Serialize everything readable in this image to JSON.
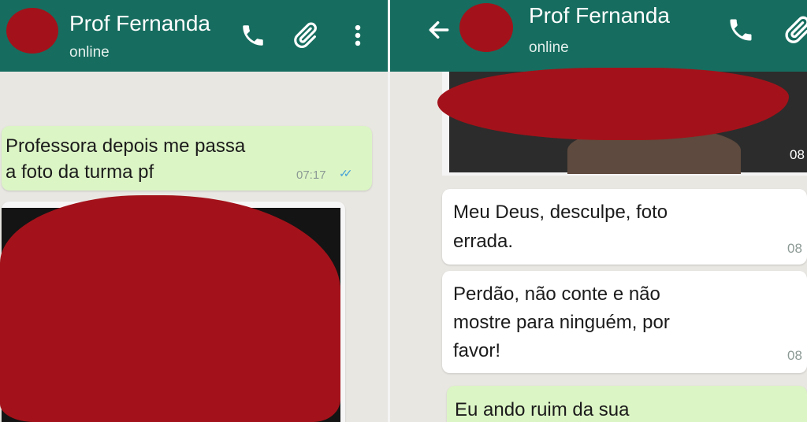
{
  "left_chat": {
    "contact_name": "Prof Fernanda",
    "status": "online",
    "icons": [
      "phone-icon",
      "attach-icon",
      "menu-icon"
    ],
    "messages": [
      {
        "text_line1": "Professora depois me passa",
        "text_line2": "a foto da turma pf",
        "time": "07:17",
        "read_status": "✓✓"
      }
    ]
  },
  "right_chat": {
    "contact_name": "Prof Fernanda",
    "status": "online",
    "icons": [
      "back-icon",
      "phone-icon",
      "attach-icon"
    ],
    "image_time": "08",
    "messages": [
      {
        "text_line1": "Meu Deus, desculpe, foto",
        "text_line2": "errada.",
        "time": "08"
      },
      {
        "text_line1": "Perdão, não conte e não",
        "text_line2": "mostre para ninguém, por",
        "text_line3": "favor!",
        "time": "08"
      },
      {
        "text_line1": "Eu ando ruim da sua"
      }
    ]
  },
  "colors": {
    "header": "#166d5f",
    "chat_background": "#e9e7e2",
    "outgoing_bubble": "#dcf5c5",
    "incoming_bubble": "#ffffff",
    "redaction": "#a3121a"
  }
}
